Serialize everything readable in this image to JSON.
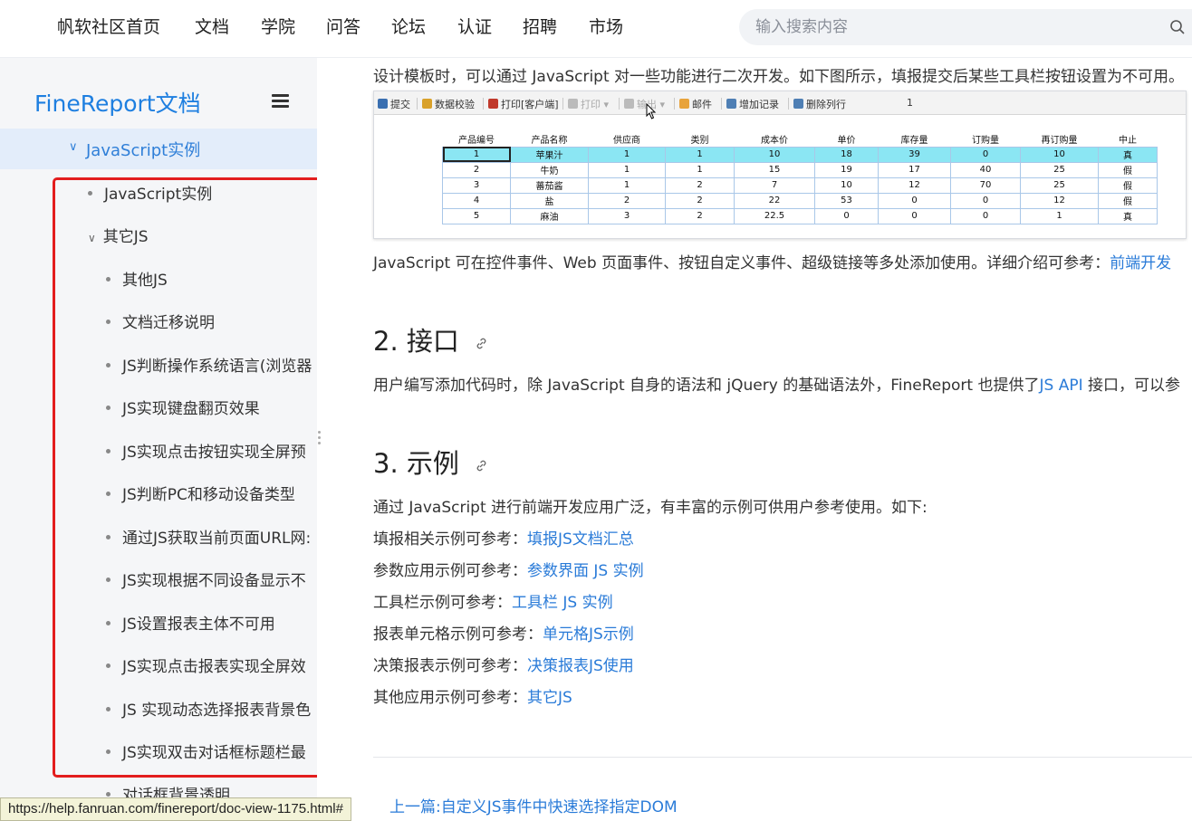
{
  "nav": {
    "items": [
      "帆软社区首页",
      "文档",
      "学院",
      "问答",
      "论坛",
      "认证",
      "招聘",
      "市场"
    ],
    "search_placeholder": "输入搜索内容"
  },
  "sidebar": {
    "brand": "FineReport文档",
    "active": "JavaScript实例",
    "items": [
      {
        "label": "JavaScript实例",
        "type": "leaf"
      },
      {
        "label": "其它JS",
        "type": "group"
      },
      {
        "label": "其他JS",
        "type": "leaf"
      },
      {
        "label": "文档迁移说明",
        "type": "leaf"
      },
      {
        "label": "JS判断操作系统语言(浏览器",
        "type": "leaf"
      },
      {
        "label": "JS实现键盘翻页效果",
        "type": "leaf"
      },
      {
        "label": "JS实现点击按钮实现全屏预",
        "type": "leaf"
      },
      {
        "label": "JS判断PC和移动设备类型",
        "type": "leaf"
      },
      {
        "label": "通过JS获取当前页面URL网:",
        "type": "leaf"
      },
      {
        "label": "JS实现根据不同设备显示不",
        "type": "leaf"
      },
      {
        "label": "JS设置报表主体不可用",
        "type": "leaf"
      },
      {
        "label": "JS实现点击报表实现全屏效",
        "type": "leaf"
      },
      {
        "label": "JS 实现动态选择报表背景色",
        "type": "leaf"
      },
      {
        "label": "JS实现双击对话框标题栏最",
        "type": "leaf"
      },
      {
        "label": "对话框背景透明",
        "type": "leaf"
      }
    ]
  },
  "content": {
    "intro": "设计模板时，可以通过 JavaScript 对一些功能进行二次开发。如下图所示，填报提交后某些工具栏按钮设置为不可用。",
    "usage_text": "JavaScript 可在控件事件、Web 页面事件、按钮自定义事件、超级链接等多处添加使用。详细介绍可参考：",
    "usage_link": "前端开发",
    "h2_api": "2. 接口",
    "api_pre": "用户编写添加代码时，除  JavaScript 自身的语法和 jQuery 的基础语法外，FineReport 也提供了",
    "api_link": "JS API",
    "api_post": " 接口，可以参",
    "h3_example": "3. 示例",
    "example_intro": "通过 JavaScript 进行前端开发应用广泛，有丰富的示例可供用户参考使用。如下:",
    "examples": [
      {
        "label": "填报相关示例可参考：",
        "link": "填报JS文档汇总"
      },
      {
        "label": "参数应用示例可参考：",
        "link": "参数界面 JS 实例"
      },
      {
        "label": "工具栏示例可参考：",
        "link": "工具栏 JS 实例"
      },
      {
        "label": "报表单元格示例可参考：",
        "link": "单元格JS示例"
      },
      {
        "label": "决策报表示例可参考：",
        "link": "决策报表JS使用"
      },
      {
        "label": "其他应用示例可参考：",
        "link": "其它JS"
      }
    ],
    "prev_label": "上一篇:",
    "prev_link": "自定义JS事件中快速选择指定DOM"
  },
  "figure": {
    "toolbar": [
      "提交",
      "数据校验",
      "打印[客户端]",
      "打印",
      "输出",
      "邮件",
      "增加记录",
      "删除列行"
    ],
    "page_num": "1",
    "headers": [
      "产品编号",
      "产品名称",
      "供应商",
      "类别",
      "成本价",
      "单价",
      "库存量",
      "订购量",
      "再订购量",
      "中止"
    ],
    "rows": [
      [
        "1",
        "苹果汁",
        "1",
        "1",
        "10",
        "18",
        "39",
        "0",
        "10",
        "真"
      ],
      [
        "2",
        "牛奶",
        "1",
        "1",
        "15",
        "19",
        "17",
        "40",
        "25",
        "假"
      ],
      [
        "3",
        "蕃茄酱",
        "1",
        "2",
        "7",
        "10",
        "12",
        "70",
        "25",
        "假"
      ],
      [
        "4",
        "盐",
        "2",
        "2",
        "22",
        "53",
        "0",
        "0",
        "12",
        "假"
      ],
      [
        "5",
        "麻油",
        "3",
        "2",
        "22.5",
        "0",
        "0",
        "0",
        "1",
        "真"
      ]
    ]
  },
  "status_url": "https://help.fanruan.com/finereport/doc-view-1175.html#"
}
